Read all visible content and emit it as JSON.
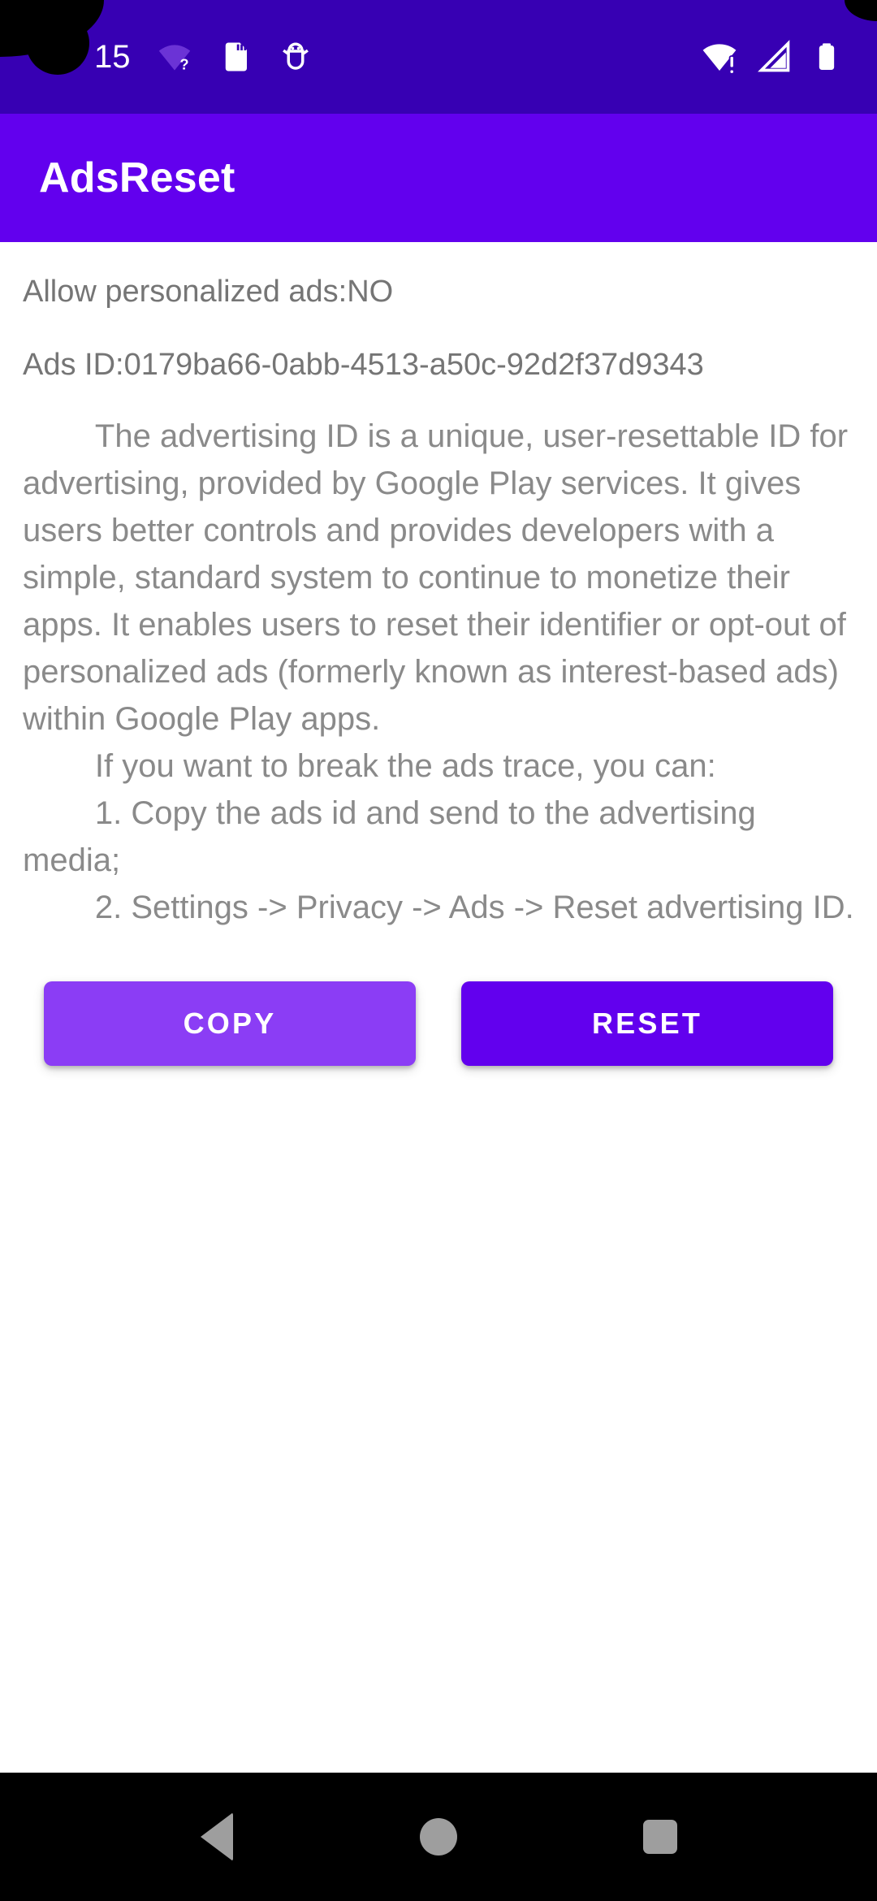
{
  "status_bar": {
    "clock": "15",
    "background_color": "#3700B3",
    "left_icons": [
      {
        "name": "wifi-no-internet-icon",
        "glyph": "wifi?"
      },
      {
        "name": "sd-card-icon",
        "glyph": "sdcard"
      },
      {
        "name": "android-debug-icon",
        "glyph": "bugdroid"
      }
    ],
    "right_icons": [
      {
        "name": "wifi-alert-icon",
        "glyph": "wifi!"
      },
      {
        "name": "cellular-signal-icon",
        "glyph": "signal"
      },
      {
        "name": "battery-full-icon",
        "glyph": "battery"
      }
    ]
  },
  "app_bar": {
    "title": "AdsReset",
    "background_color": "#6200EE",
    "text_color": "#FFFFFF"
  },
  "main": {
    "personalized_ads_line": "Allow personalized ads:NO",
    "ads_id_line": "Ads ID:0179ba66-0abb-4513-a50c-92d2f37d9343",
    "ads_id_value": "0179ba66-0abb-4513-a50c-92d2f37d9343",
    "personalized_ads_value": "NO",
    "description": "        The advertising ID is a unique, user-resettable ID for advertising, provided by Google Play services. It gives users better controls and provides developers with a simple, standard system to continue to monetize their apps. It enables users to reset their identifier or opt-out of personalized ads (formerly known as interest-based ads) within Google Play apps.\n        If you want to break the ads trace, you can:\n        1. Copy the ads id and send to the advertising media;\n        2. Settings -> Privacy -> Ads -> Reset advertising ID.",
    "text_color": "#8A8A8A"
  },
  "buttons": {
    "copy_label": "COPY",
    "copy_color": "#8B3DF5",
    "reset_label": "RESET",
    "reset_color": "#6200EE"
  },
  "nav_bar": {
    "background_color": "#000000",
    "icon_color": "#9E9E9E",
    "items": [
      {
        "name": "back-button",
        "label": "Back"
      },
      {
        "name": "home-button",
        "label": "Home"
      },
      {
        "name": "recents-button",
        "label": "Recents"
      }
    ]
  }
}
